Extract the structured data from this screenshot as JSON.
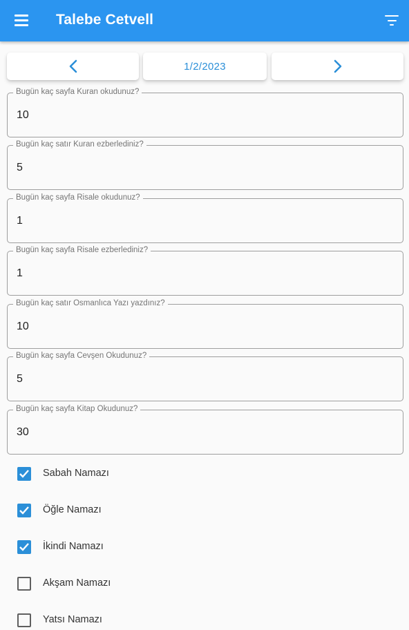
{
  "appbar": {
    "title": "Talebe Cetvell",
    "color": "#2b95f0"
  },
  "nav": {
    "date": "1/2/2023",
    "accent": "#2b8fd8"
  },
  "fields": [
    {
      "label": "Bugün kaç sayfa Kuran okudunuz?",
      "value": "10"
    },
    {
      "label": "Bugün kaç satır Kuran ezberlediniz?",
      "value": "5"
    },
    {
      "label": "Bugün kaç sayfa Risale okudunuz?",
      "value": "1"
    },
    {
      "label": "Bugün kaç sayfa Risale ezberlediniz?",
      "value": "1"
    },
    {
      "label": "Bugün kaç satır Osmanlıca Yazı yazdınız?",
      "value": "10"
    },
    {
      "label": "Bugün kaç sayfa Cevşen Okudunuz?",
      "value": "5"
    },
    {
      "label": "Bugün kaç sayfa Kitap Okudunuz?",
      "value": "30"
    }
  ],
  "prayers": [
    {
      "label": "Sabah Namazı",
      "checked": true
    },
    {
      "label": "Öğle Namazı",
      "checked": true
    },
    {
      "label": "İkindi Namazı",
      "checked": true
    },
    {
      "label": "Akşam Namazı",
      "checked": false
    },
    {
      "label": "Yatsı Namazı",
      "checked": false
    }
  ]
}
